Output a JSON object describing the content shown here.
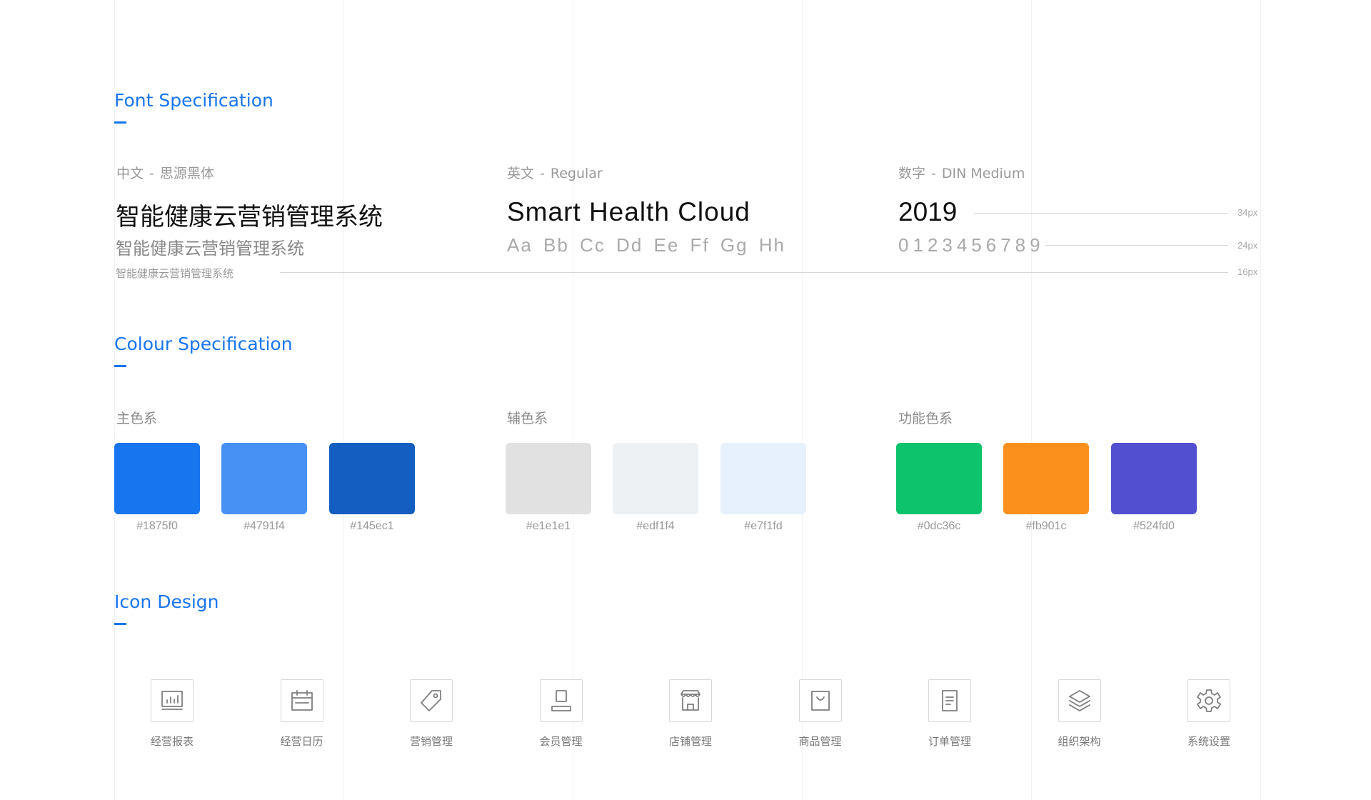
{
  "sections": {
    "font_title": "Font Specification",
    "colour_title": "Colour Specification",
    "icon_title": "Icon Design"
  },
  "font_spec": {
    "chinese": {
      "label_lang": "中文",
      "label_sep": "-",
      "label_font": "思源黑体",
      "sample": "智能健康云营销管理系统"
    },
    "english": {
      "label_lang": "英文",
      "label_sep": "-",
      "label_font": "Regular",
      "sample": "Smart Health Cloud",
      "alphabet": "Aa Bb Cc Dd Ee Ff Gg Hh"
    },
    "numbers": {
      "label_lang": "数字",
      "label_sep": "-",
      "label_font": "DIN Medium",
      "sample": "2019",
      "digits": "0123456789"
    },
    "sizes": [
      "34px",
      "24px",
      "16px"
    ]
  },
  "colour_spec": {
    "groups": [
      {
        "label": "主色系",
        "swatches": [
          {
            "color": "#1875f0",
            "hex": "#1875f0"
          },
          {
            "color": "#4791f4",
            "hex": "#4791f4"
          },
          {
            "color": "#145ec1",
            "hex": "#145ec1"
          }
        ]
      },
      {
        "label": "辅色系",
        "swatches": [
          {
            "color": "#e1e1e1",
            "hex": "#e1e1e1"
          },
          {
            "color": "#edf1f4",
            "hex": "#edf1f4"
          },
          {
            "color": "#e7f1fd",
            "hex": "#e7f1fd"
          }
        ]
      },
      {
        "label": "功能色系",
        "swatches": [
          {
            "color": "#0dc36c",
            "hex": "#0dc36c"
          },
          {
            "color": "#fb901c",
            "hex": "#fb901c"
          },
          {
            "color": "#524fd0",
            "hex": "#524fd0"
          }
        ]
      }
    ]
  },
  "icons": [
    {
      "icon": "report-chart-icon",
      "label": "经营报表"
    },
    {
      "icon": "calendar-icon",
      "label": "经营日历"
    },
    {
      "icon": "tag-icon",
      "label": "营销管理"
    },
    {
      "icon": "member-icon",
      "label": "会员管理"
    },
    {
      "icon": "store-icon",
      "label": "店铺管理"
    },
    {
      "icon": "shopping-bag-icon",
      "label": "商品管理"
    },
    {
      "icon": "order-document-icon",
      "label": "订单管理"
    },
    {
      "icon": "layers-icon",
      "label": "组织架构"
    },
    {
      "icon": "settings-gear-icon",
      "label": "系统设置"
    }
  ],
  "accent_color": "#1875f0"
}
